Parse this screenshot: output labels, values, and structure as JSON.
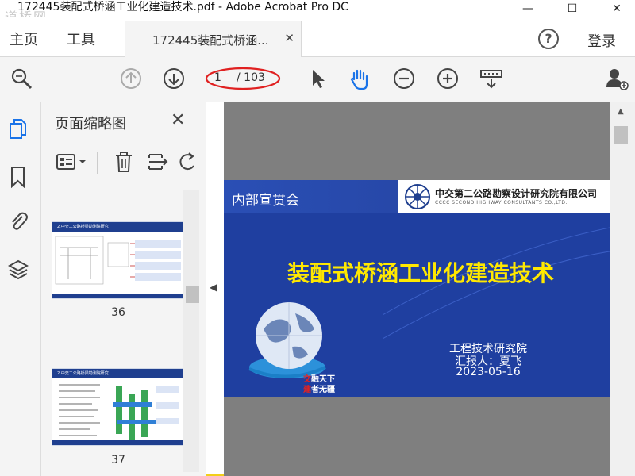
{
  "window": {
    "title": "172445装配式桥涵工业化建造技术.pdf - Adobe Acrobat Pro DC",
    "watermark": "道桥网",
    "minimize": "—",
    "maximize": "☐",
    "close": "✕"
  },
  "menu": {
    "home": "主页",
    "tools": "工具",
    "doc_tab": "172445装配式桥涵...",
    "doc_tab_close": "✕",
    "help": "?",
    "login": "登录"
  },
  "toolbar": {
    "current_page": "1",
    "total_pages": "/ 103",
    "highlight_color": "#e02020"
  },
  "thumbnails": {
    "title": "页面缩略图",
    "close": "✕",
    "pages": [
      {
        "number": "36",
        "header": "2.中交二公路桥梁勘测院研究"
      },
      {
        "number": "37",
        "header": "2.中交二公路桥梁勘测院研究"
      }
    ]
  },
  "slide": {
    "meeting": "内部宣贯会",
    "company_cn": "中交第二公路勘察设计研究院有限公司",
    "company_en": "CCCC SECOND HIGHWAY CONSULTANTS CO.,LTD.",
    "title": "装配式桥涵工业化建造技术",
    "dept": "工程技术研究院",
    "reporter": "汇报人：夏飞",
    "date": "2023-05-16",
    "slogan1": "交融天下",
    "slogan2": "建者无疆",
    "bg_color": "#1f3fa0",
    "title_color": "#ffe800"
  },
  "colors": {
    "frame": "#f2cf1a",
    "accent": "#1a73e8"
  }
}
